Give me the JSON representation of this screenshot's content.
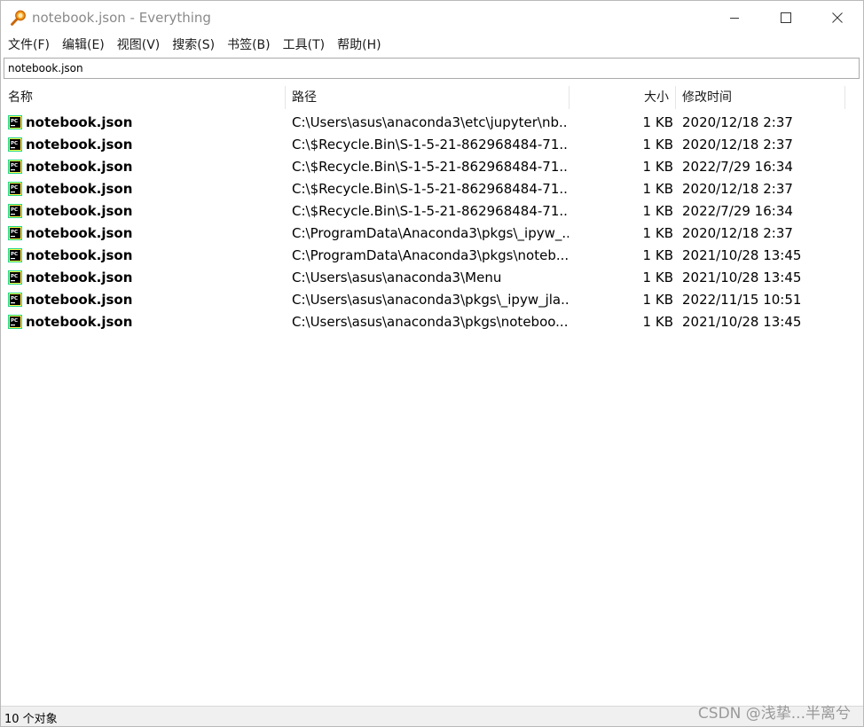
{
  "window": {
    "title": "notebook.json - Everything",
    "app_icon": "magnifier-icon",
    "controls": [
      "minimize-icon",
      "maximize-icon",
      "close-icon"
    ]
  },
  "menu": {
    "items": [
      "文件(F)",
      "编辑(E)",
      "视图(V)",
      "搜索(S)",
      "书签(B)",
      "工具(T)",
      "帮助(H)"
    ]
  },
  "search": {
    "value": "notebook.json"
  },
  "columns": {
    "name": "名称",
    "path": "路径",
    "size": "大小",
    "modified": "修改时间"
  },
  "rows": [
    {
      "name": "notebook.json",
      "path": "C:\\Users\\asus\\anaconda3\\etc\\jupyter\\nb...",
      "size": "1 KB",
      "modified": "2020/12/18 2:37",
      "icon": "pycharm-file-icon"
    },
    {
      "name": "notebook.json",
      "path": "C:\\$Recycle.Bin\\S-1-5-21-862968484-71...",
      "size": "1 KB",
      "modified": "2020/12/18 2:37",
      "icon": "pycharm-file-icon"
    },
    {
      "name": "notebook.json",
      "path": "C:\\$Recycle.Bin\\S-1-5-21-862968484-71...",
      "size": "1 KB",
      "modified": "2022/7/29 16:34",
      "icon": "pycharm-file-icon"
    },
    {
      "name": "notebook.json",
      "path": "C:\\$Recycle.Bin\\S-1-5-21-862968484-71...",
      "size": "1 KB",
      "modified": "2020/12/18 2:37",
      "icon": "pycharm-file-icon"
    },
    {
      "name": "notebook.json",
      "path": "C:\\$Recycle.Bin\\S-1-5-21-862968484-71...",
      "size": "1 KB",
      "modified": "2022/7/29 16:34",
      "icon": "pycharm-file-icon"
    },
    {
      "name": "notebook.json",
      "path": "C:\\ProgramData\\Anaconda3\\pkgs\\_ipyw_...",
      "size": "1 KB",
      "modified": "2020/12/18 2:37",
      "icon": "pycharm-file-icon"
    },
    {
      "name": "notebook.json",
      "path": "C:\\ProgramData\\Anaconda3\\pkgs\\noteb...",
      "size": "1 KB",
      "modified": "2021/10/28 13:45",
      "icon": "pycharm-file-icon"
    },
    {
      "name": "notebook.json",
      "path": "C:\\Users\\asus\\anaconda3\\Menu",
      "size": "1 KB",
      "modified": "2021/10/28 13:45",
      "icon": "pycharm-file-icon"
    },
    {
      "name": "notebook.json",
      "path": "C:\\Users\\asus\\anaconda3\\pkgs\\_ipyw_jla...",
      "size": "1 KB",
      "modified": "2022/11/15 10:51",
      "icon": "pycharm-file-icon"
    },
    {
      "name": "notebook.json",
      "path": "C:\\Users\\asus\\anaconda3\\pkgs\\noteboo...",
      "size": "1 KB",
      "modified": "2021/10/28 13:45",
      "icon": "pycharm-file-icon"
    }
  ],
  "status": {
    "text": "10 个对象"
  },
  "watermark": {
    "text": "CSDN @浅挚...半离兮"
  },
  "colors": {
    "title_text": "#8a8a8a",
    "icon_green": "#21d789",
    "icon_yellow": "#fcf84a",
    "statusbar_bg": "#f0f0f0"
  }
}
